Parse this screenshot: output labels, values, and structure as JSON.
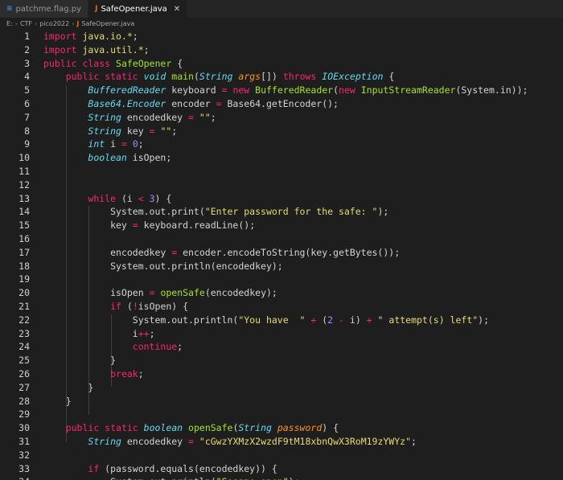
{
  "tabs": [
    {
      "label": "patchme.flag.py",
      "icon": "python-file-icon",
      "active": false
    },
    {
      "label": "SafeOpener.java",
      "icon": "java-file-icon",
      "active": true
    }
  ],
  "breadcrumb": [
    "E:",
    "CTF",
    "pico2022",
    "SafeOpener.java"
  ],
  "code_lines": [
    {
      "n": "1",
      "tokens": [
        [
          "kw",
          "import "
        ],
        [
          "st",
          "java.io.*"
        ],
        [
          "pl",
          ";"
        ]
      ]
    },
    {
      "n": "2",
      "tokens": [
        [
          "kw",
          "import "
        ],
        [
          "st",
          "java.util.*"
        ],
        [
          "pl",
          ";"
        ]
      ]
    },
    {
      "n": "3",
      "tokens": [
        [
          "kw",
          "public class "
        ],
        [
          "fn",
          "SafeOpener"
        ],
        [
          "pl",
          " {"
        ]
      ]
    },
    {
      "n": "4",
      "tokens": [
        [
          "pl",
          "    "
        ],
        [
          "kw",
          "public static "
        ],
        [
          "ty",
          "void"
        ],
        [
          "pl",
          " "
        ],
        [
          "fn",
          "main"
        ],
        [
          "pl",
          "("
        ],
        [
          "ty",
          "String"
        ],
        [
          "pl",
          " "
        ],
        [
          "pa",
          "args"
        ],
        [
          "pl",
          "[]) "
        ],
        [
          "kw",
          "throws"
        ],
        [
          "pl",
          " "
        ],
        [
          "ty",
          "IOException"
        ],
        [
          "pl",
          " {"
        ]
      ]
    },
    {
      "n": "5",
      "tokens": [
        [
          "pl",
          "        "
        ],
        [
          "ty",
          "BufferedReader"
        ],
        [
          "pl",
          " keyboard "
        ],
        [
          "kw",
          "="
        ],
        [
          "pl",
          " "
        ],
        [
          "kw",
          "new "
        ],
        [
          "fn",
          "BufferedReader"
        ],
        [
          "pl",
          "("
        ],
        [
          "kw",
          "new "
        ],
        [
          "fn",
          "InputStreamReader"
        ],
        [
          "pl",
          "(System.in));"
        ]
      ]
    },
    {
      "n": "6",
      "tokens": [
        [
          "pl",
          "        "
        ],
        [
          "ty",
          "Base64.Encoder"
        ],
        [
          "pl",
          " encoder "
        ],
        [
          "kw",
          "="
        ],
        [
          "pl",
          " Base64.getEncoder();"
        ]
      ]
    },
    {
      "n": "7",
      "tokens": [
        [
          "pl",
          "        "
        ],
        [
          "ty",
          "String"
        ],
        [
          "pl",
          " encodedkey "
        ],
        [
          "kw",
          "="
        ],
        [
          "pl",
          " "
        ],
        [
          "st",
          "\"\""
        ],
        [
          "pl",
          ";"
        ]
      ]
    },
    {
      "n": "8",
      "tokens": [
        [
          "pl",
          "        "
        ],
        [
          "ty",
          "String"
        ],
        [
          "pl",
          " key "
        ],
        [
          "kw",
          "="
        ],
        [
          "pl",
          " "
        ],
        [
          "st",
          "\"\""
        ],
        [
          "pl",
          ";"
        ]
      ]
    },
    {
      "n": "9",
      "tokens": [
        [
          "pl",
          "        "
        ],
        [
          "ty",
          "int"
        ],
        [
          "pl",
          " i "
        ],
        [
          "kw",
          "="
        ],
        [
          "pl",
          " "
        ],
        [
          "nm",
          "0"
        ],
        [
          "pl",
          ";"
        ]
      ]
    },
    {
      "n": "10",
      "tokens": [
        [
          "pl",
          "        "
        ],
        [
          "ty",
          "boolean"
        ],
        [
          "pl",
          " isOpen;"
        ]
      ]
    },
    {
      "n": "11",
      "tokens": []
    },
    {
      "n": "12",
      "tokens": []
    },
    {
      "n": "13",
      "tokens": [
        [
          "pl",
          "        "
        ],
        [
          "kw",
          "while"
        ],
        [
          "pl",
          " (i "
        ],
        [
          "kw",
          "<"
        ],
        [
          "pl",
          " "
        ],
        [
          "nm",
          "3"
        ],
        [
          "pl",
          ") {"
        ]
      ]
    },
    {
      "n": "14",
      "tokens": [
        [
          "pl",
          "            System.out.print("
        ],
        [
          "st",
          "\"Enter password for the safe: \""
        ],
        [
          "pl",
          ");"
        ]
      ]
    },
    {
      "n": "15",
      "tokens": [
        [
          "pl",
          "            key "
        ],
        [
          "kw",
          "="
        ],
        [
          "pl",
          " keyboard.readLine();"
        ]
      ]
    },
    {
      "n": "16",
      "tokens": []
    },
    {
      "n": "17",
      "tokens": [
        [
          "pl",
          "            encodedkey "
        ],
        [
          "kw",
          "="
        ],
        [
          "pl",
          " encoder.encodeToString(key.getBytes());"
        ]
      ]
    },
    {
      "n": "18",
      "tokens": [
        [
          "pl",
          "            System.out.println(encodedkey);"
        ]
      ]
    },
    {
      "n": "19",
      "tokens": []
    },
    {
      "n": "20",
      "tokens": [
        [
          "pl",
          "            isOpen "
        ],
        [
          "kw",
          "="
        ],
        [
          "pl",
          " "
        ],
        [
          "fn",
          "openSafe"
        ],
        [
          "pl",
          "(encodedkey);"
        ]
      ]
    },
    {
      "n": "21",
      "tokens": [
        [
          "pl",
          "            "
        ],
        [
          "kw",
          "if"
        ],
        [
          "pl",
          " ("
        ],
        [
          "kw",
          "!"
        ],
        [
          "pl",
          "isOpen) {"
        ]
      ]
    },
    {
      "n": "22",
      "tokens": [
        [
          "pl",
          "                System.out.println("
        ],
        [
          "st",
          "\"You have  \""
        ],
        [
          "pl",
          " "
        ],
        [
          "kw",
          "+"
        ],
        [
          "pl",
          " ("
        ],
        [
          "nm",
          "2"
        ],
        [
          "pl",
          " "
        ],
        [
          "kw",
          "-"
        ],
        [
          "pl",
          " i) "
        ],
        [
          "kw",
          "+"
        ],
        [
          "pl",
          " "
        ],
        [
          "st",
          "\" attempt(s) left\""
        ],
        [
          "pl",
          ");"
        ]
      ]
    },
    {
      "n": "23",
      "tokens": [
        [
          "pl",
          "                i"
        ],
        [
          "kw",
          "++"
        ],
        [
          "pl",
          ";"
        ]
      ]
    },
    {
      "n": "24",
      "tokens": [
        [
          "pl",
          "                "
        ],
        [
          "kw",
          "continue"
        ],
        [
          "pl",
          ";"
        ]
      ]
    },
    {
      "n": "25",
      "tokens": [
        [
          "pl",
          "            }"
        ]
      ]
    },
    {
      "n": "26",
      "tokens": [
        [
          "pl",
          "            "
        ],
        [
          "kw",
          "break"
        ],
        [
          "pl",
          ";"
        ]
      ]
    },
    {
      "n": "27",
      "tokens": [
        [
          "pl",
          "        }"
        ]
      ]
    },
    {
      "n": "28",
      "tokens": [
        [
          "pl",
          "    }"
        ]
      ]
    },
    {
      "n": "29",
      "tokens": []
    },
    {
      "n": "30",
      "tokens": [
        [
          "pl",
          "    "
        ],
        [
          "kw",
          "public static "
        ],
        [
          "ty",
          "boolean"
        ],
        [
          "pl",
          " "
        ],
        [
          "fn",
          "openSafe"
        ],
        [
          "pl",
          "("
        ],
        [
          "ty",
          "String"
        ],
        [
          "pl",
          " "
        ],
        [
          "pa",
          "password"
        ],
        [
          "pl",
          ") {"
        ]
      ]
    },
    {
      "n": "31",
      "tokens": [
        [
          "pl",
          "        "
        ],
        [
          "ty",
          "String"
        ],
        [
          "pl",
          " encodedkey "
        ],
        [
          "kw",
          "="
        ],
        [
          "pl",
          " "
        ],
        [
          "st",
          "\"cGwzYXMzX2wzdF9tM18xbnQwX3RoM19zYWYz\""
        ],
        [
          "pl",
          ";"
        ]
      ]
    },
    {
      "n": "32",
      "tokens": []
    },
    {
      "n": "33",
      "tokens": [
        [
          "pl",
          "        "
        ],
        [
          "kw",
          "if"
        ],
        [
          "pl",
          " (password.equals(encodedkey)) {"
        ]
      ]
    },
    {
      "n": "34",
      "tokens": [
        [
          "pl",
          "            System.out.println("
        ],
        [
          "st",
          "\"Sesame open\""
        ],
        [
          "pl",
          ");"
        ]
      ]
    }
  ]
}
